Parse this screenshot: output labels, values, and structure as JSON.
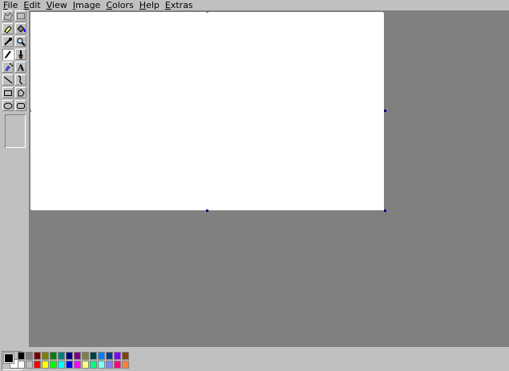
{
  "menu": [
    {
      "u": "F",
      "rest": "ile"
    },
    {
      "u": "E",
      "rest": "dit"
    },
    {
      "u": "V",
      "rest": "iew"
    },
    {
      "u": "I",
      "rest": "mage"
    },
    {
      "u": "C",
      "rest": "olors"
    },
    {
      "u": "H",
      "rest": "elp"
    },
    {
      "u": "E",
      "rest": "xtras"
    }
  ],
  "tools": [
    {
      "name": "free-select-tool",
      "icon": "free-select-icon"
    },
    {
      "name": "rect-select-tool",
      "icon": "rect-select-icon"
    },
    {
      "name": "eraser-tool",
      "icon": "eraser-icon"
    },
    {
      "name": "fill-tool",
      "icon": "paint-bucket-icon"
    },
    {
      "name": "pick-color-tool",
      "icon": "eyedropper-icon"
    },
    {
      "name": "magnifier-tool",
      "icon": "magnifier-icon"
    },
    {
      "name": "pencil-tool",
      "icon": "pencil-icon",
      "active": true
    },
    {
      "name": "brush-tool",
      "icon": "brush-icon"
    },
    {
      "name": "airbrush-tool",
      "icon": "airbrush-icon"
    },
    {
      "name": "text-tool",
      "icon": "text-icon",
      "glyph": "A"
    },
    {
      "name": "line-tool",
      "icon": "line-icon"
    },
    {
      "name": "curve-tool",
      "icon": "curve-icon"
    },
    {
      "name": "rectangle-tool",
      "icon": "rectangle-icon"
    },
    {
      "name": "polygon-tool",
      "icon": "polygon-icon"
    },
    {
      "name": "ellipse-tool",
      "icon": "ellipse-icon"
    },
    {
      "name": "rounded-rectangle-tool",
      "icon": "rounded-rectangle-icon"
    }
  ],
  "colors": {
    "foreground": "#000000",
    "background": "#ffffff",
    "palette_top": [
      "#000000",
      "#808080",
      "#800000",
      "#808000",
      "#008000",
      "#008080",
      "#000080",
      "#800080",
      "#808040",
      "#004040",
      "#0080ff",
      "#004080",
      "#8000ff",
      "#804000"
    ],
    "palette_bottom": [
      "#ffffff",
      "#c0c0c0",
      "#ff0000",
      "#ffff00",
      "#00ff00",
      "#00ffff",
      "#0000ff",
      "#ff00ff",
      "#ffff80",
      "#00ff80",
      "#80ffff",
      "#8080ff",
      "#ff0080",
      "#ff8040"
    ]
  }
}
